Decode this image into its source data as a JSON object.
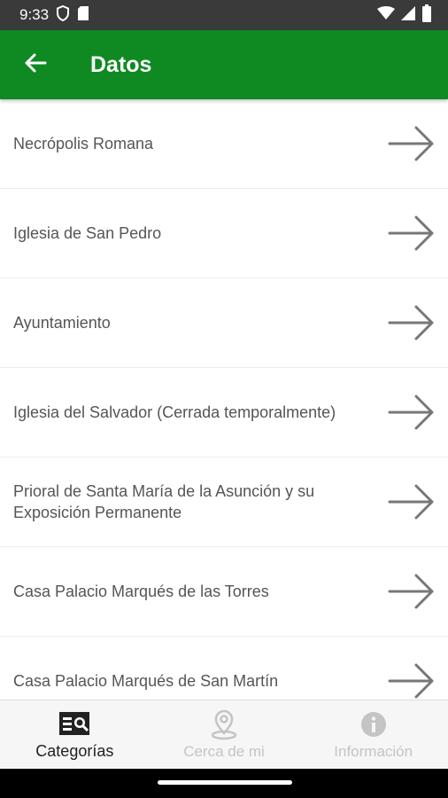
{
  "status_bar": {
    "time": "9:33"
  },
  "app_bar": {
    "title": "Datos"
  },
  "list": {
    "items": [
      {
        "label": "Necrópolis Romana"
      },
      {
        "label": "Iglesia de San Pedro"
      },
      {
        "label": "Ayuntamiento"
      },
      {
        "label": "Iglesia del Salvador (Cerrada temporalmente)"
      },
      {
        "label": "Prioral de Santa María de la Asunción y su Exposición Permanente"
      },
      {
        "label": "Casa Palacio Marqués de las Torres"
      },
      {
        "label": "Casa Palacio Marqués de San Martín"
      }
    ]
  },
  "bottom_nav": {
    "items": [
      {
        "label": "Categorías",
        "icon": "map-book-icon",
        "active": true
      },
      {
        "label": "Cerca de mi",
        "icon": "location-pin-icon",
        "active": false
      },
      {
        "label": "Información",
        "icon": "info-icon",
        "active": false
      }
    ]
  },
  "colors": {
    "app_bar": "#0f8a23",
    "status_bar": "#3a3a3a",
    "inactive_nav": "#c4c4c4",
    "list_text": "#555555"
  }
}
